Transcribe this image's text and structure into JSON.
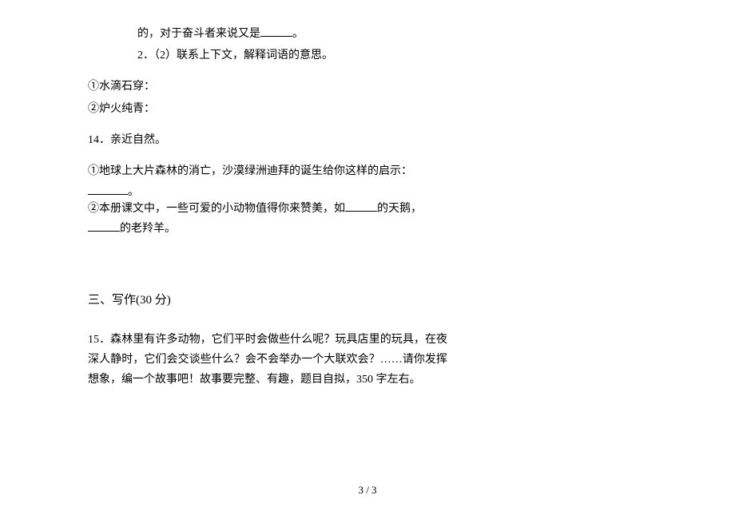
{
  "q13": {
    "line1_pre": "的，对于奋斗者来说又是",
    "line1_post": "。",
    "item2_num": "2．",
    "item2_text": "（2）联系上下文，解释词语的意思。",
    "sub1": "①水滴石穿：",
    "sub2": "②炉火纯青："
  },
  "q14": {
    "num": "14．",
    "title": "亲近自然。",
    "p1": "①地球上大片森林的消亡，沙漠绿洲迪拜的诞生给你这样的启示：",
    "p1_blank_post": "。",
    "p2_pre": "②本册课文中，一些可爱的小动物值得你来赞美，如",
    "p2_mid": "的天鹅，",
    "p2_post": "的老羚羊。"
  },
  "section3": {
    "heading": "三、写作(30 分)"
  },
  "q15": {
    "num": "15．",
    "text1": "森林里有许多动物，它们平时会做些什么呢？玩具店里的玩具，在夜深人静时，它们会交谈些什么？会不会举办一个大联欢会？……请你发挥想象，编一个故事吧！故事要完整、有趣，题目自拟，350 字左右。"
  },
  "footer": {
    "page": "3 / 3"
  }
}
